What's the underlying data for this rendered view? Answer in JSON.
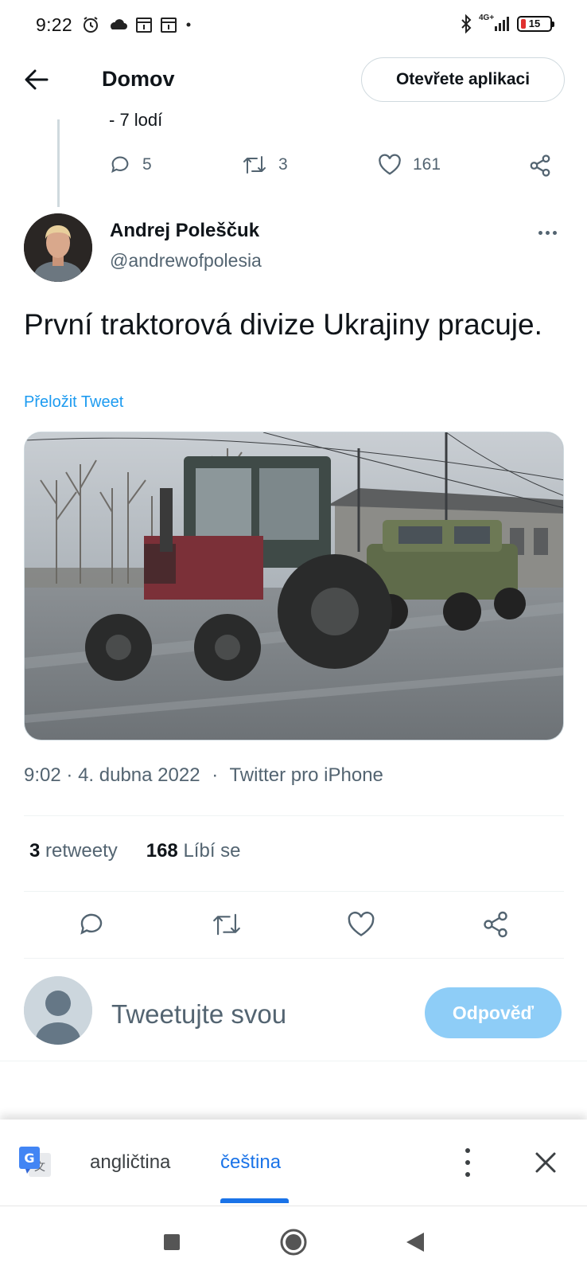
{
  "status_bar": {
    "time": "9:22",
    "network": "4G+",
    "battery": "15",
    "battery_color": "#e0312f"
  },
  "header": {
    "back_icon": "arrow-left-icon",
    "title": "Domov",
    "open_app_label": "Otevřete aplikaci"
  },
  "previous_tweet": {
    "text_fragment": "- 7 lodí",
    "replies": "5",
    "retweets": "3",
    "likes": "161"
  },
  "tweet": {
    "author_name": "Andrej Poleščuk",
    "author_handle": "@andrewofpolesia",
    "text": "První traktorová divize Ukrajiny pracuje.",
    "translate_label": "Přeložit Tweet",
    "time": "9:02",
    "date": "4. dubna 2022",
    "meta_separator": "·",
    "source": "Twitter pro iPhone",
    "retweets_count": "3",
    "retweets_label": "retweety",
    "likes_count": "168",
    "likes_label": "Líbí se"
  },
  "reply": {
    "placeholder": "Tweetujte svou",
    "button_label": "Odpověď"
  },
  "translate_bar": {
    "source_lang": "angličtina",
    "target_lang": "čeština",
    "accent_color": "#1a73e8"
  },
  "theme": {
    "twitter_blue": "#1d9bf0",
    "muted_text": "#536471"
  }
}
